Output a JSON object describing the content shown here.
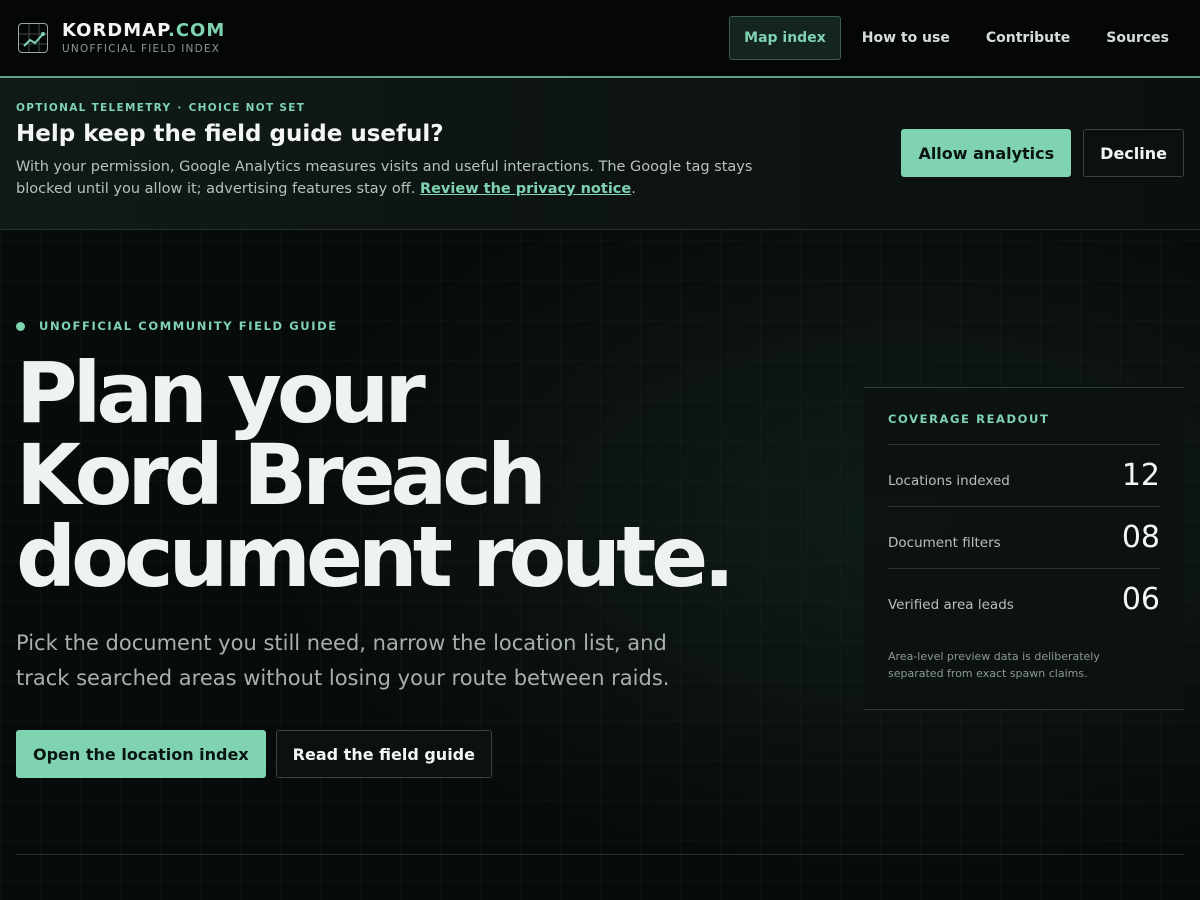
{
  "brand": {
    "name": "KORDMAP",
    "tld": ".COM",
    "tagline": "UNOFFICIAL FIELD INDEX"
  },
  "nav": {
    "items": [
      {
        "label": "Map index",
        "active": true
      },
      {
        "label": "How to use"
      },
      {
        "label": "Contribute"
      },
      {
        "label": "Sources"
      }
    ]
  },
  "consent": {
    "eyebrow_left": "OPTIONAL TELEMETRY",
    "eyebrow_sep": "·",
    "eyebrow_right": "CHOICE NOT SET",
    "title": "Help keep the field guide useful?",
    "body": "With your permission, Google Analytics measures visits and useful interactions. The Google tag stays blocked until you allow it; advertising features stay off. ",
    "link": "Review the privacy notice",
    "body_end": ".",
    "allow_label": "Allow analytics",
    "decline_label": "Decline"
  },
  "hero": {
    "eyebrow": "UNOFFICIAL COMMUNITY FIELD GUIDE",
    "title_lines": [
      "Plan your",
      "Kord Breach",
      "document route."
    ],
    "subtitle": "Pick the document you still need, narrow the location list, and track searched areas without losing your route between raids.",
    "primary_cta": "Open the location index",
    "secondary_cta": "Read the field guide"
  },
  "readout": {
    "title": "COVERAGE READOUT",
    "rows": [
      {
        "label": "Locations indexed",
        "value": "12"
      },
      {
        "label": "Document filters",
        "value": "08"
      },
      {
        "label": "Verified area leads",
        "value": "06"
      }
    ],
    "note": "Area-level preview data is deliberately separated from exact spawn claims."
  },
  "colors": {
    "accent": "#7fd3b1",
    "background": "#080b0b"
  },
  "icons": {
    "brand_logo": "chart-grid-icon",
    "hero_marker": "status-dot-icon"
  }
}
